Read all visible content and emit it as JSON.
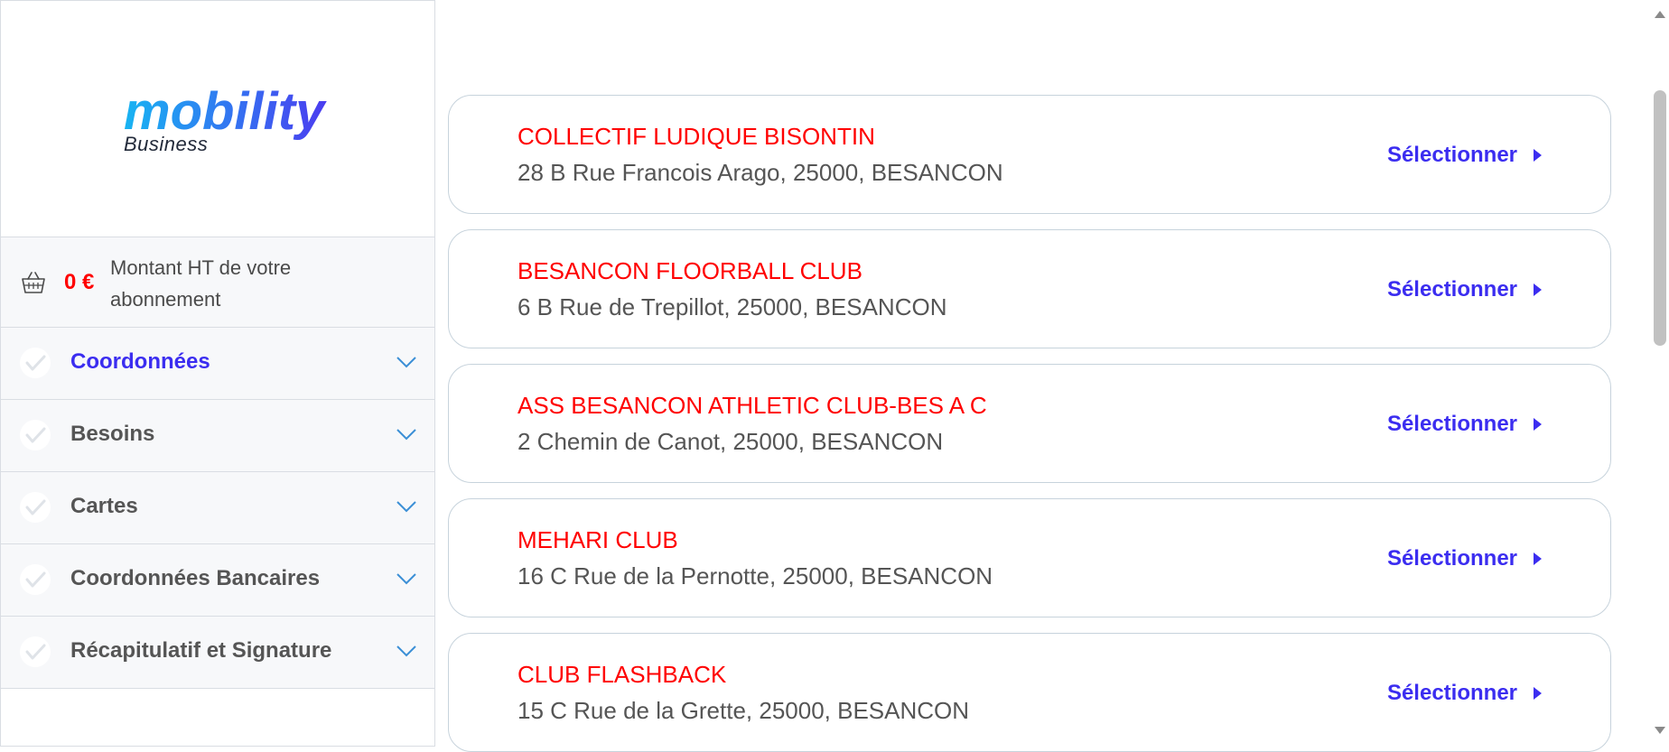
{
  "brand": {
    "name": "mobility",
    "sub": "Business"
  },
  "summary": {
    "amount": "0 €",
    "label": "Montant HT de votre abonnement"
  },
  "steps": [
    {
      "label": "Coordonnées",
      "active": true
    },
    {
      "label": "Besoins",
      "active": false
    },
    {
      "label": "Cartes",
      "active": false
    },
    {
      "label": "Coordonnées Bancaires",
      "active": false
    },
    {
      "label": "Récapitulatif et Signature",
      "active": false
    }
  ],
  "results": [
    {
      "name": "COLLECTIF LUDIQUE BISONTIN",
      "address": "28 B Rue Francois Arago, 25000, BESANCON",
      "action": "Sélectionner"
    },
    {
      "name": "BESANCON FLOORBALL CLUB",
      "address": "6 B Rue de Trepillot, 25000, BESANCON",
      "action": "Sélectionner"
    },
    {
      "name": "ASS BESANCON ATHLETIC CLUB-BES A C",
      "address": "2 Chemin de Canot, 25000, BESANCON",
      "action": "Sélectionner"
    },
    {
      "name": "MEHARI CLUB",
      "address": "16 C Rue de la Pernotte, 25000, BESANCON",
      "action": "Sélectionner"
    },
    {
      "name": "CLUB FLASHBACK",
      "address": "15 C Rue de la Grette, 25000, BESANCON",
      "action": "Sélectionner"
    }
  ],
  "colors": {
    "accent": "#3b2df0",
    "name_red": "#ff0000",
    "text_gray": "#555555",
    "chevron_blue": "#3b8fd6",
    "logo_gradient_start": "#18b4f2",
    "logo_gradient_end": "#4b3cf0"
  },
  "icons": {
    "basket": "basket-icon",
    "check": "check-icon",
    "chevron": "chevron-down-icon",
    "arrow": "caret-right-icon"
  }
}
